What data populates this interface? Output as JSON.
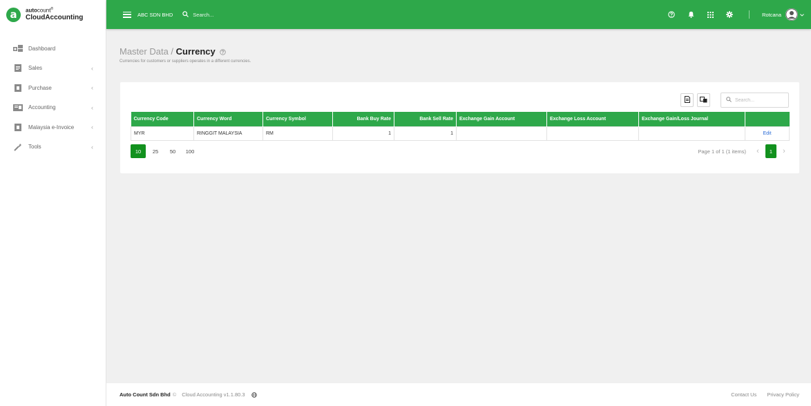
{
  "brand": {
    "small_prefix": "auto",
    "small_suffix": "count",
    "trademark": "®",
    "name": "CloudAccounting",
    "logo_letter": "a",
    "color": "#2ea84a"
  },
  "topbar": {
    "company": "ABC SDN BHD",
    "search_placeholder": "Search...",
    "user_name": "Rotcana"
  },
  "sidebar": {
    "items": [
      {
        "label": "Dashboard",
        "icon": "dashboard-icon",
        "expandable": false
      },
      {
        "label": "Sales",
        "icon": "sales-icon",
        "expandable": true
      },
      {
        "label": "Purchase",
        "icon": "purchase-icon",
        "expandable": true
      },
      {
        "label": "Accounting",
        "icon": "accounting-icon",
        "expandable": true
      },
      {
        "label": "Malaysia e-Invoice",
        "icon": "einvoice-icon",
        "expandable": true
      },
      {
        "label": "Tools",
        "icon": "wrench-icon",
        "expandable": true
      }
    ],
    "chevron": "‹"
  },
  "page": {
    "breadcrumb_parent": "Master Data",
    "separator": " / ",
    "title": "Currency",
    "subtitle": "Currencies for customers or suppliers operates in a different currencies."
  },
  "card": {
    "search_placeholder": "Search..."
  },
  "table": {
    "columns": [
      "Currency Code",
      "Currency Word",
      "Currency Symbol",
      "Bank Buy Rate",
      "Bank Sell Rate",
      "Exchange Gain Account",
      "Exchange Loss Account",
      "Exchange Gain/Loss Journal",
      ""
    ],
    "rows": [
      [
        "MYR",
        "RINGGIT MALAYSIA",
        "RM",
        "1",
        "1",
        "",
        "",
        "",
        "Edit"
      ]
    ]
  },
  "pagination": {
    "page_sizes": [
      "10",
      "25",
      "50",
      "100"
    ],
    "active_size": "10",
    "info": "Page 1 of 1 (1 items)",
    "current_page": "1",
    "prev": "‹",
    "next": "›"
  },
  "footer": {
    "company": "Auto Count Sdn Bhd",
    "copyright": "©",
    "version": "Cloud Accounting v1.1.80.3",
    "contact": "Contact Us",
    "privacy": "Privacy Policy"
  },
  "colors": {
    "primary": "#2ea84a",
    "primary_dark": "#12911e",
    "link": "#2a6bd6"
  }
}
